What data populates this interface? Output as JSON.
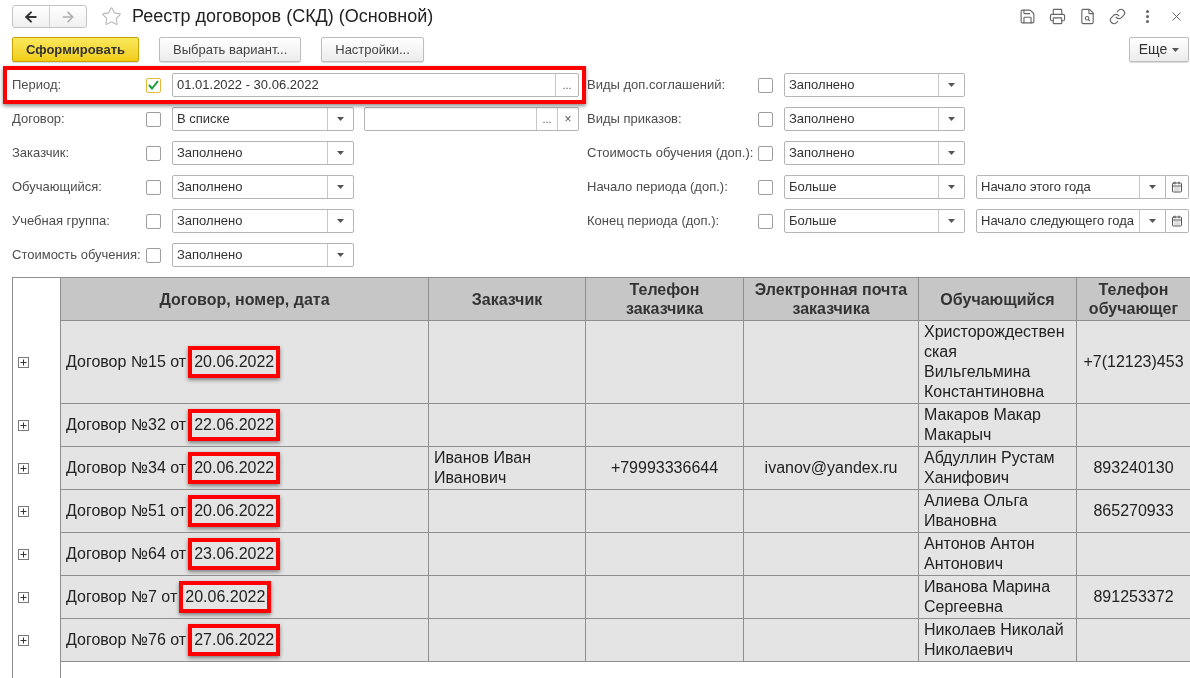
{
  "window": {
    "title": "Реестр договоров (СКД) (Основной)",
    "favorite": false
  },
  "navigation": {
    "back_disabled": false,
    "forward_disabled": true
  },
  "toolbar": {
    "buttons": [
      {
        "label": "Сформировать",
        "kind": "primary"
      },
      {
        "label": "Выбрать вариант...",
        "kind": "secondary"
      },
      {
        "label": "Настройки...",
        "kind": "secondary"
      }
    ],
    "more_button": "Еще"
  },
  "filters": {
    "left": [
      {
        "kind": "period",
        "label": "Период:",
        "checked": true,
        "highlighted": true,
        "value": "01.01.2022 - 30.06.2022",
        "select_button": "..."
      },
      {
        "kind": "list",
        "label": "Договор:",
        "checked": false,
        "condition": "В списке",
        "select_button": "...",
        "clear_button": "×"
      },
      {
        "kind": "condition",
        "label": "Заказчик:",
        "checked": false,
        "condition": "Заполнено"
      },
      {
        "kind": "condition",
        "label": "Обучающийся:",
        "checked": false,
        "condition": "Заполнено"
      },
      {
        "kind": "condition",
        "label": "Учебная группа:",
        "checked": false,
        "condition": "Заполнено"
      },
      {
        "kind": "condition",
        "label": "Стоимость обучения:",
        "checked": false,
        "condition": "Заполнено"
      }
    ],
    "right": [
      {
        "kind": "condition",
        "label": "Виды доп.соглашений:",
        "checked": false,
        "condition": "Заполнено"
      },
      {
        "kind": "condition",
        "label": "Виды приказов:",
        "checked": false,
        "condition": "Заполнено"
      },
      {
        "kind": "condition",
        "label": "Стоимость обучения (доп.):",
        "checked": false,
        "condition": "Заполнено"
      },
      {
        "kind": "date",
        "label": "Начало периода (доп.):",
        "checked": false,
        "condition": "Больше",
        "value": "Начало этого года"
      },
      {
        "kind": "date",
        "label": "Конец периода (доп.):",
        "checked": false,
        "condition": "Больше",
        "value": "Начало следующего года"
      }
    ]
  },
  "table": {
    "columns": [
      "Договор, номер, дата",
      "Заказчик",
      "Телефон заказчика",
      "Электронная почта заказчика",
      "Обучающийся",
      "Телефон обучающег"
    ],
    "rows": [
      {
        "expanded": false,
        "contract": "Договор №15 от",
        "date": "20.06.2022",
        "date_highlighted": true,
        "student": "Христорождественская Вильгельмина Константиновна",
        "student_phone": "+7(12123)453"
      },
      {
        "expanded": false,
        "contract": "Договор №32 от",
        "date": "22.06.2022",
        "date_highlighted": true,
        "student": "Макаров Макар Макарыч"
      },
      {
        "expanded": false,
        "contract": "Договор №34 от",
        "date": "20.06.2022",
        "date_highlighted": true,
        "customer": "Иванов Иван Иванович",
        "customer_phone": "+79993336644",
        "customer_email": "ivanov@yandex.ru",
        "student": "Абдуллин Рустам Ханифович",
        "student_phone": "893240130"
      },
      {
        "expanded": false,
        "contract": "Договор №51 от",
        "date": "20.06.2022",
        "date_highlighted": true,
        "student": "Алиева Ольга Ивановна",
        "student_phone": "865270933"
      },
      {
        "expanded": false,
        "contract": "Договор №64 от",
        "date": "23.06.2022",
        "date_highlighted": true,
        "student": "Антонов Антон Антонович"
      },
      {
        "expanded": false,
        "contract": "Договор №7 от",
        "date": "20.06.2022",
        "date_highlighted": true,
        "student": "Иванова Марина Сергеевна",
        "student_phone": "891253372"
      },
      {
        "expanded": false,
        "contract": "Договор №76 от",
        "date": "27.06.2022",
        "date_highlighted": true,
        "student": "Николаев Николай Николаевич"
      }
    ]
  }
}
